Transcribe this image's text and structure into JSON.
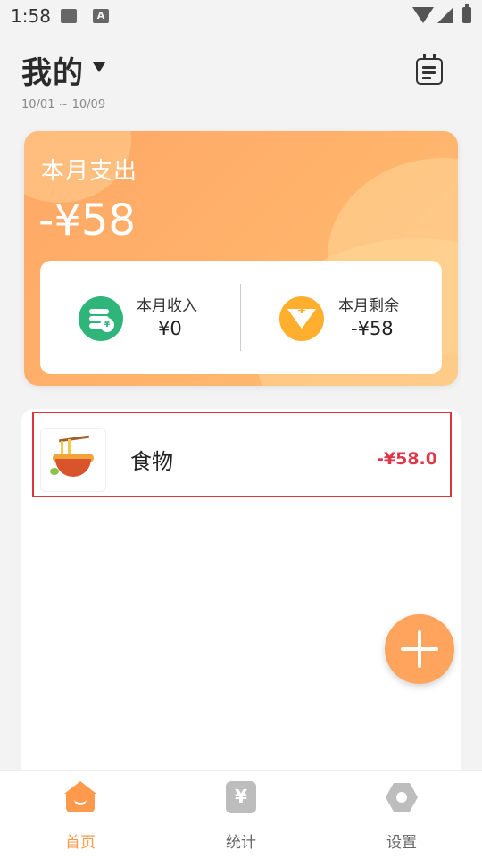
{
  "status_bar": {
    "time": "1:58",
    "a_icon_text": "A"
  },
  "header": {
    "title": "我的",
    "date_range": "10/01 ~ 10/09"
  },
  "summary": {
    "expense_label": "本月支出",
    "expense_amount": "-¥58",
    "income_label": "本月收入",
    "income_value": "¥0",
    "balance_label": "本月剩余",
    "balance_value": "-¥58",
    "coin_symbol": "¥",
    "balance_symbol": "¥"
  },
  "records": [
    {
      "category": "食物",
      "amount": "-¥58.0",
      "icon": "noodle-bowl-icon"
    }
  ],
  "bottom_nav": {
    "home": "首页",
    "stats": "统计",
    "stats_symbol": "¥",
    "settings": "设置"
  },
  "colors": {
    "accent": "#ff9a4d",
    "expense_red": "#e0364a",
    "income_green": "#2fb57a",
    "balance_yellow": "#ffae2e"
  }
}
